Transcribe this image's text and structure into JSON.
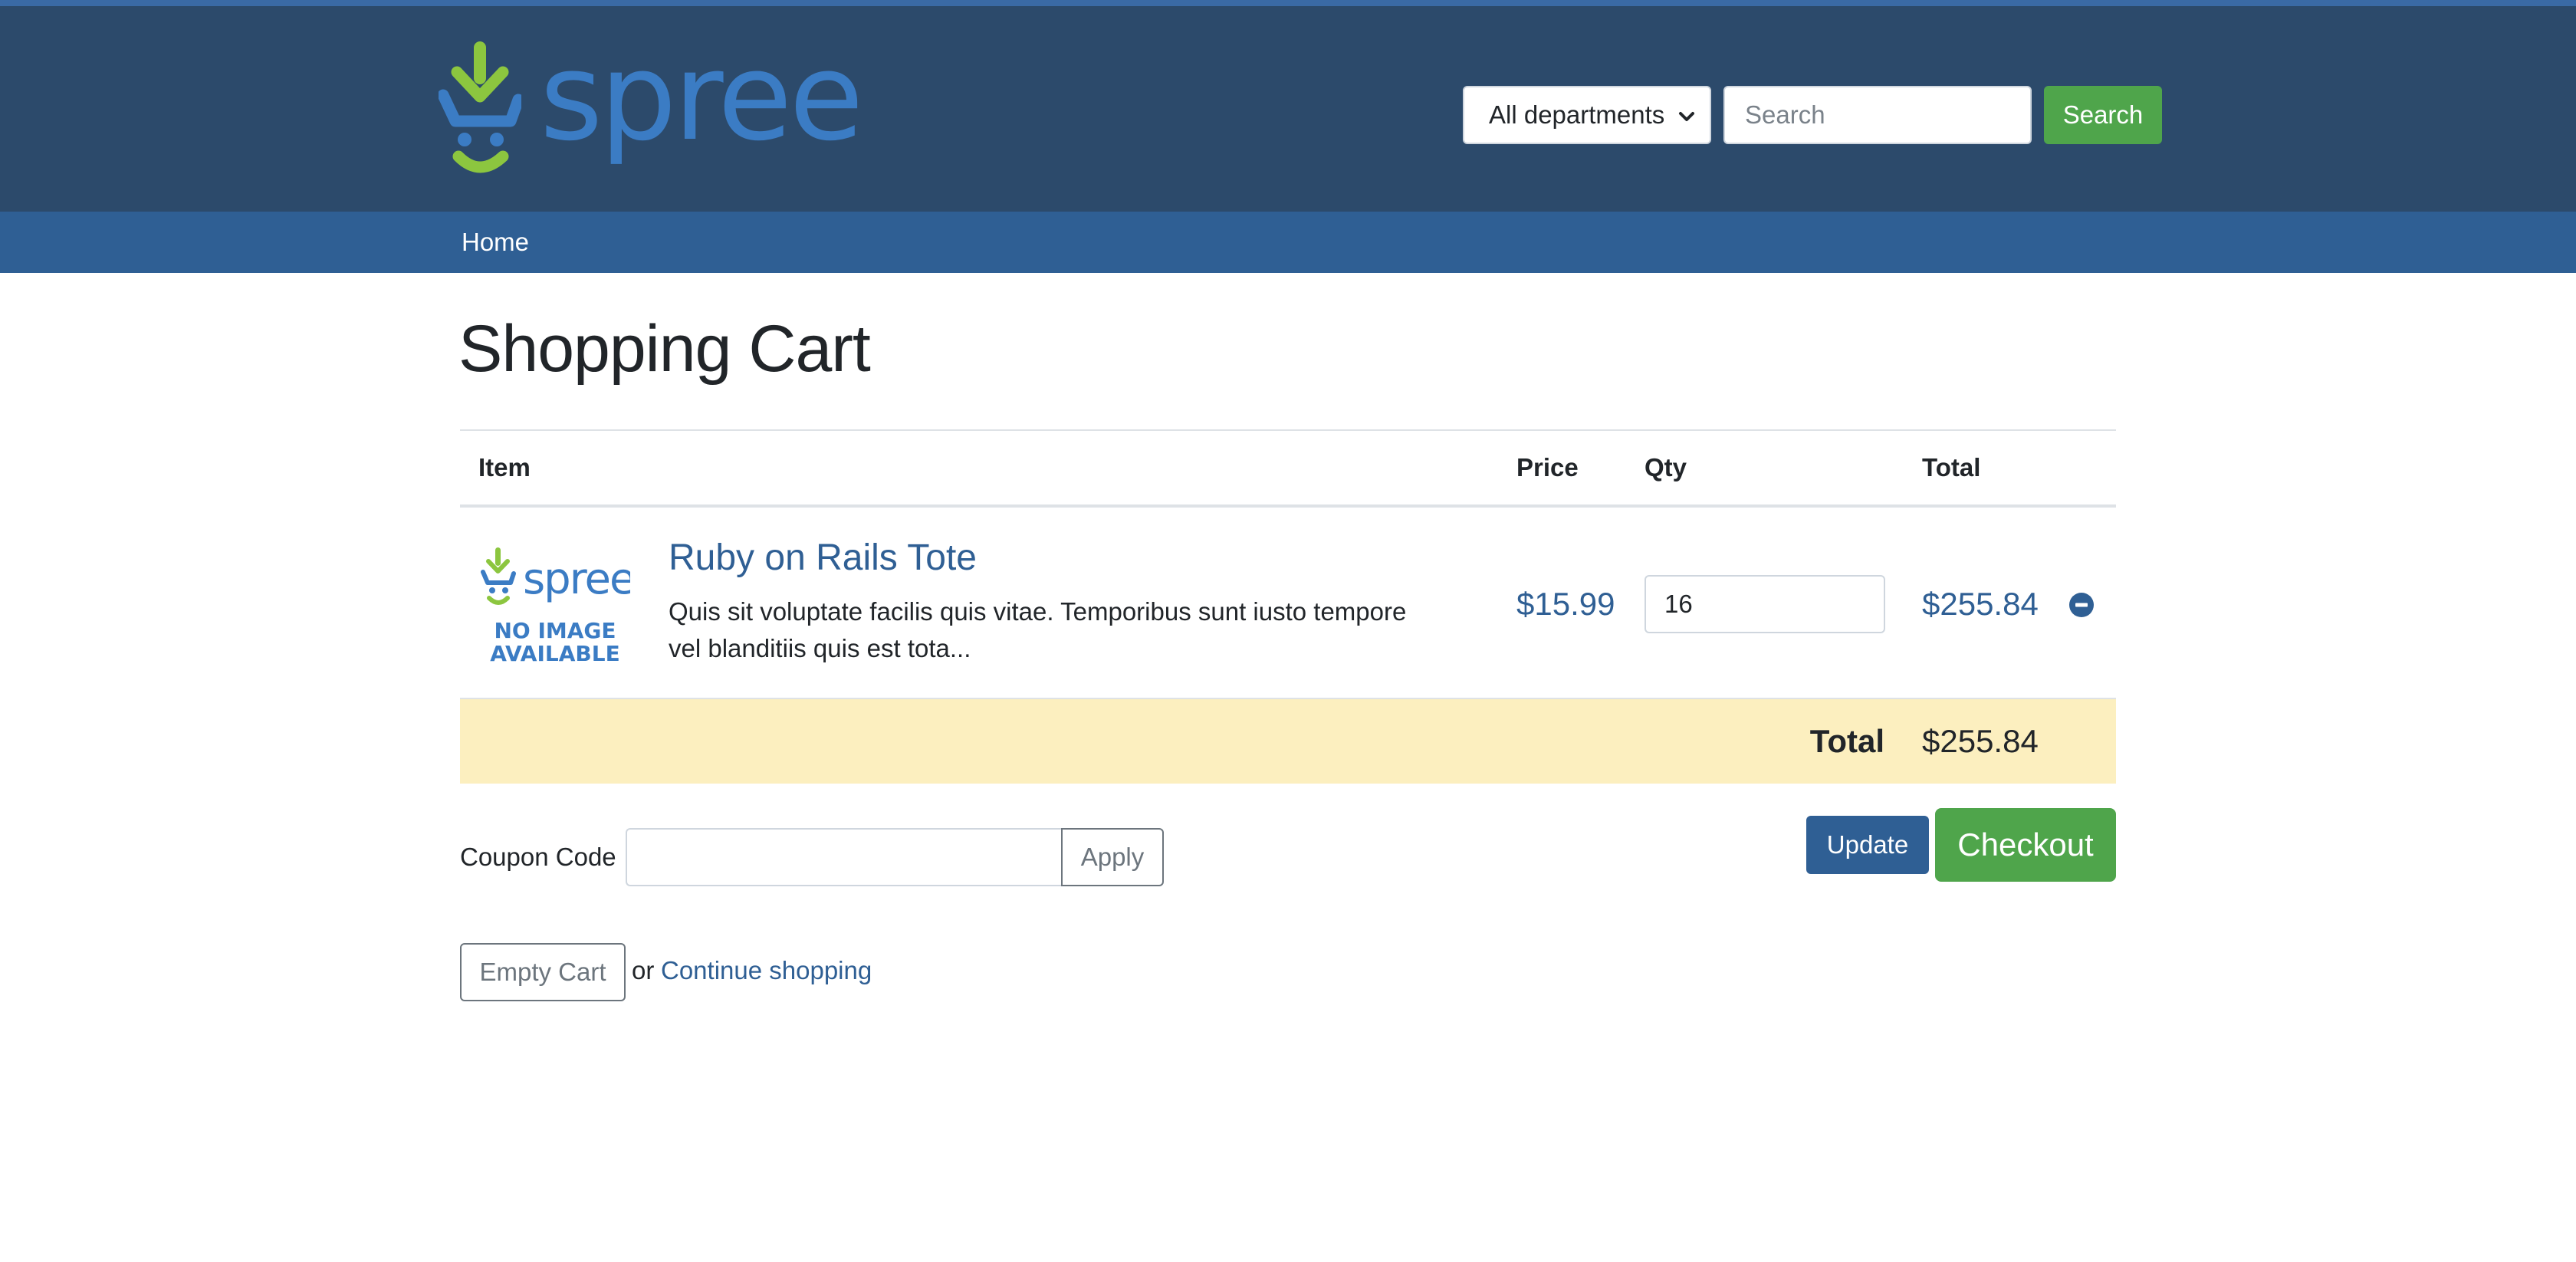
{
  "header": {
    "logo_text": "spree",
    "department_select": {
      "selected": "All departments"
    },
    "search": {
      "placeholder": "Search",
      "value": "",
      "button_label": "Search"
    }
  },
  "nav": {
    "items": [
      {
        "label": "Home"
      }
    ]
  },
  "page": {
    "title": "Shopping Cart"
  },
  "cart": {
    "columns": {
      "item": "Item",
      "price": "Price",
      "qty": "Qty",
      "total": "Total"
    },
    "items": [
      {
        "thumbnail_logo": "spree",
        "thumbnail_text_line1": "NO IMAGE",
        "thumbnail_text_line2": "AVAILABLE",
        "name": "Ruby on Rails Tote",
        "description": "Quis sit voluptate facilis quis vitae. Temporibus sunt iusto tempore vel blanditiis quis est tota...",
        "price": "$15.99",
        "qty": "16",
        "total": "$255.84",
        "remove_icon": "minus-circle-icon"
      }
    ],
    "summary": {
      "label": "Total",
      "value": "$255.84"
    }
  },
  "coupon": {
    "label": "Coupon Code",
    "value": "",
    "apply_label": "Apply"
  },
  "actions": {
    "update_label": "Update",
    "checkout_label": "Checkout",
    "empty_label": "Empty Cart",
    "or_text": "or",
    "continue_label": "Continue shopping"
  },
  "colors": {
    "header_bg": "#2c4a6b",
    "nav_bg": "#2f5f94",
    "brand_blue": "#3b7cc4",
    "brand_green": "#8cc63f",
    "success": "#4fa54b",
    "totals_bg": "#fcefbf"
  }
}
